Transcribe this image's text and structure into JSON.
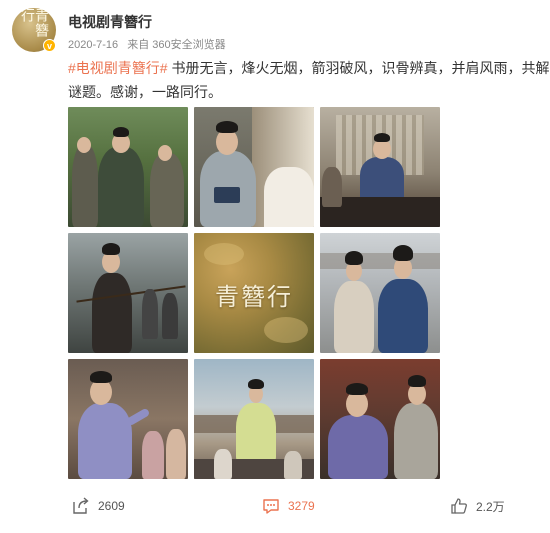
{
  "account": {
    "name": "电视剧青簪行",
    "avatar_text": "青簪行",
    "verified_badge": "v"
  },
  "meta": {
    "date": "2020-7-16",
    "source": "来自 360安全浏览器"
  },
  "post": {
    "hashtag": "#电视剧青簪行#",
    "body": " 书册无言，烽火无烟，箭羽破风，识骨辨真，并肩风雨，共解谜题。感谢，一路同行。"
  },
  "grid": {
    "center_caption": "青簪行",
    "images": [
      {
        "name": "image-1",
        "icon": "photo"
      },
      {
        "name": "image-2",
        "icon": "photo"
      },
      {
        "name": "image-3",
        "icon": "photo"
      },
      {
        "name": "image-4",
        "icon": "photo"
      },
      {
        "name": "image-5",
        "icon": "photo"
      },
      {
        "name": "image-6",
        "icon": "photo"
      },
      {
        "name": "image-7",
        "icon": "photo"
      },
      {
        "name": "image-8",
        "icon": "photo"
      },
      {
        "name": "image-9",
        "icon": "photo"
      }
    ]
  },
  "actions": {
    "share_count": "2609",
    "comment_count": "3279",
    "like_count": "2.2万",
    "share_icon": "share-icon",
    "comment_icon": "comment-icon",
    "like_icon": "thumbs-up-icon"
  },
  "colors": {
    "hashtag": "#eb7350",
    "meta_text": "#888888",
    "verified": "#ffb400"
  }
}
